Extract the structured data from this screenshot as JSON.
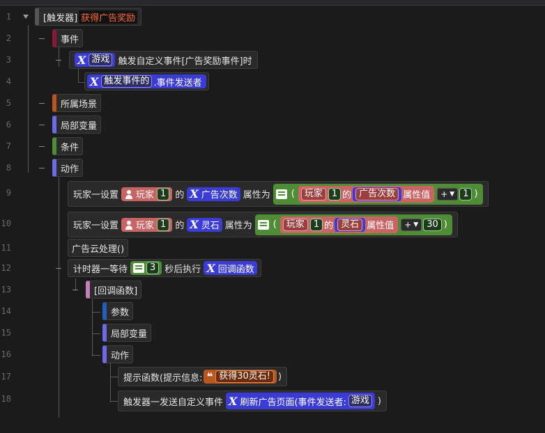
{
  "line_numbers": [
    "1",
    "2",
    "3",
    "4",
    "5",
    "6",
    "7",
    "8",
    "9",
    "10",
    "11",
    "12",
    "13",
    "14",
    "15",
    "16",
    "17",
    "18"
  ],
  "trigger": {
    "prefix": "[触发器]",
    "name": "获得广告奖励"
  },
  "sections": {
    "events": "事件",
    "scene": "所属场景",
    "local_vars": "局部变量",
    "conditions": "条件",
    "actions": "动作"
  },
  "event_line": {
    "game": "游戏",
    "text": "触发自定义事件[广告奖励事件]时"
  },
  "event_sender": {
    "fired_event": "触发事件的",
    "text": ".事件发送者"
  },
  "action1": {
    "prefix": "玩家一设置",
    "player": "玩家",
    "player_num": "1",
    "of": "的",
    "attr": "广告次数",
    "set_to": "属性为",
    "paren_open": "(",
    "player2": "玩家",
    "player2_num": "1",
    "of2": "的",
    "attr2": "广告次数",
    "attr_val": "属性值",
    "op": "+",
    "value": "1",
    "paren_close": ")"
  },
  "action2": {
    "prefix": "玩家一设置",
    "player": "玩家",
    "player_num": "1",
    "of": "的",
    "attr": "灵石",
    "set_to": "属性为",
    "paren_open": "(",
    "player2": "玩家",
    "player2_num": "1",
    "of2": "的",
    "attr2": "灵石",
    "attr_val": "属性值",
    "op": "+",
    "value": "30",
    "paren_close": ")"
  },
  "action3": {
    "text": "广告云处理()"
  },
  "timer": {
    "prefix": "计时器一等待",
    "seconds": "3",
    "after": "秒后执行",
    "callback": "回调函数"
  },
  "callback_block": {
    "title": "[回调函数]",
    "params": "参数",
    "local_vars": "局部变量",
    "actions": "动作",
    "hint": {
      "prefix": "提示函数(提示信息:",
      "message": "获得30灵石!",
      "suffix": ")"
    },
    "send": {
      "prefix": "触发器一发送自定义事件",
      "func": "刷新广告页面(事件发送者:",
      "sender": "游戏",
      "suffix": ")"
    }
  },
  "colors": {
    "background": "#1b1b1c",
    "events": "#8b1838",
    "scene": "#b9561f",
    "local_vars": "#6b6be8",
    "conditions": "#4e8c36",
    "actions": "#6b6be8",
    "callback": "#c77db6",
    "params": "#1f5fb8",
    "variable_pill": "#3b3bd6",
    "player_pill": "#c86464",
    "math_pill": "#4e8c36",
    "string_pill": "#b75820"
  },
  "icons": [
    "collapse-triangle-icon",
    "function-x-icon",
    "player-icon",
    "calculator-icon",
    "quote-icon",
    "dropdown-arrow-icon"
  ]
}
